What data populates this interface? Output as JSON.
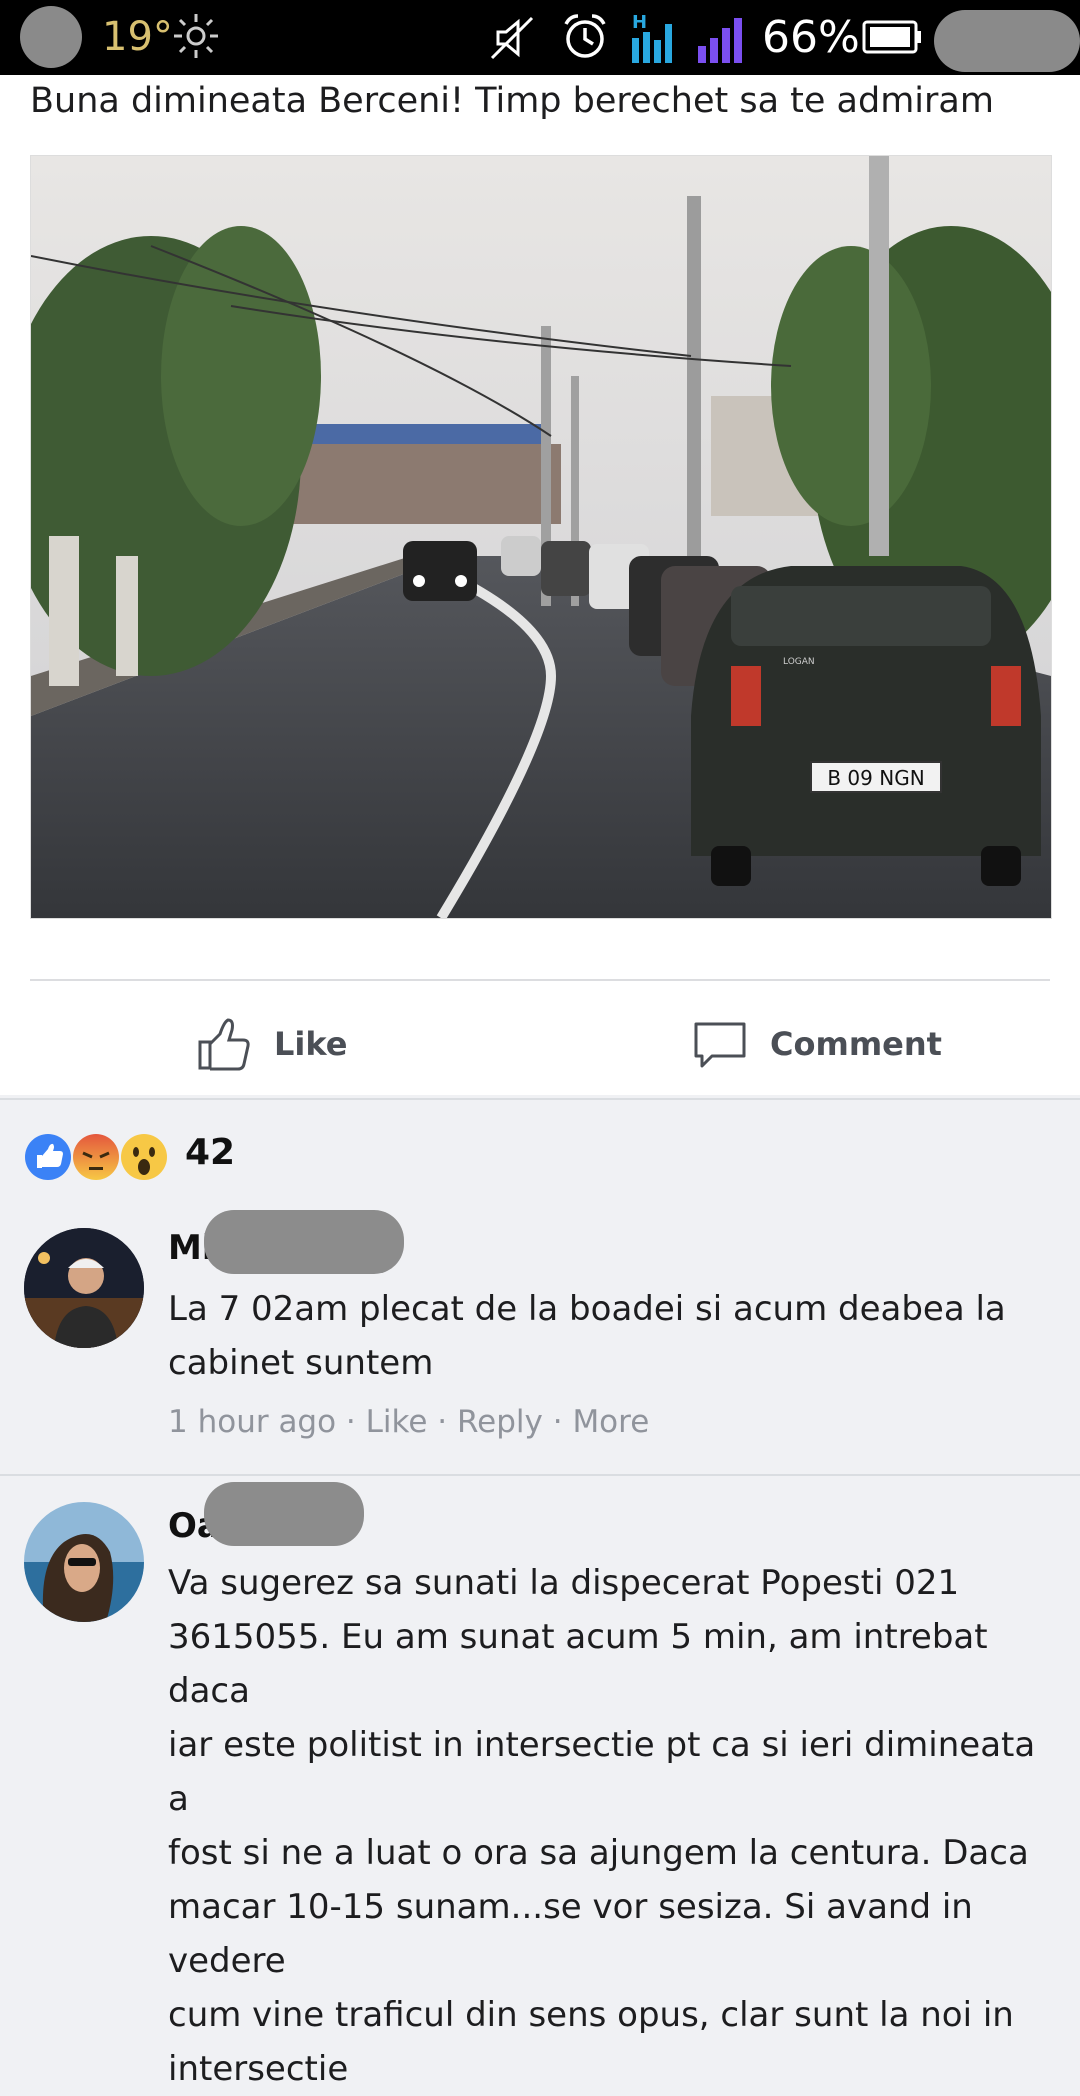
{
  "status_bar": {
    "temperature": "19°",
    "battery_percent": "66%",
    "icons": [
      "weather-sun-icon",
      "mute-icon",
      "alarm-icon",
      "signal-h-icon",
      "signal-icon",
      "battery-icon"
    ]
  },
  "post": {
    "text": "Buna dimineata Berceni! Timp berechet sa te admiram",
    "photo_plate": "B 09 NGN",
    "photo_badge": "LOGAN",
    "actions": {
      "like_label": "Like",
      "comment_label": "Comment"
    }
  },
  "reactions": {
    "icons": [
      "like-reaction-icon",
      "angry-reaction-icon",
      "wow-reaction-icon"
    ],
    "count": "42"
  },
  "comments": [
    {
      "name_visible": "Mi",
      "name_suffix": "e",
      "text_lines": [
        "La 7 02am plecat de la boadei si acum deabea la",
        "cabinet suntem"
      ],
      "meta": {
        "time": "1 hour ago",
        "sep": " · ",
        "like": "Like",
        "reply": "Reply",
        "more": "More"
      }
    },
    {
      "name_visible": "Oa",
      "text_lines": [
        "Va sugerez sa sunati la dispecerat Popesti 021",
        "3615055. Eu am sunat acum 5 min, am intrebat daca",
        "iar este politist in intersectie pt ca si ieri dimineata a",
        "fost si ne a luat o ora sa ajungem la centura. Daca",
        "macar 10-15 sunam...se vor sesiza. Si avand in vedere",
        "cum vine traficul din sens opus, clar sunt la noi in",
        "intersectie"
      ]
    }
  ],
  "colors": {
    "like_blue": "#3b82f6",
    "meta_gray": "#90949c",
    "signal_blue": "#29a8e0",
    "signal_purple": "#7b4ff0"
  }
}
